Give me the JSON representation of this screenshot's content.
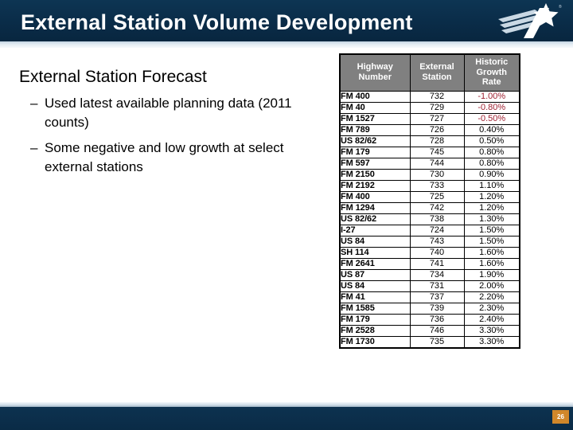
{
  "header": {
    "title": "External Station Volume Development",
    "logo_icon": "star-swoosh-logo",
    "bg_color": "#0b2f4d"
  },
  "content": {
    "heading": "External Station Forecast",
    "bullets": [
      {
        "dash": "–",
        "text": "Used latest available planning data (2011 counts)"
      },
      {
        "dash": "–",
        "text": "Some negative and low growth at select external stations"
      }
    ]
  },
  "table": {
    "columns": [
      "Highway Number",
      "External Station",
      "Historic Growth Rate"
    ],
    "header_bg": "#808080",
    "negative_color": "#a02334",
    "rows": [
      {
        "highway": "FM 400",
        "station": "732",
        "rate": "-1.00%",
        "negative": true
      },
      {
        "highway": "FM 40",
        "station": "729",
        "rate": "-0.80%",
        "negative": true
      },
      {
        "highway": "FM 1527",
        "station": "727",
        "rate": "-0.50%",
        "negative": true
      },
      {
        "highway": "FM 789",
        "station": "726",
        "rate": "0.40%",
        "negative": false
      },
      {
        "highway": "US 82/62",
        "station": "728",
        "rate": "0.50%",
        "negative": false
      },
      {
        "highway": "FM 179",
        "station": "745",
        "rate": "0.80%",
        "negative": false
      },
      {
        "highway": "FM 597",
        "station": "744",
        "rate": "0.80%",
        "negative": false
      },
      {
        "highway": "FM 2150",
        "station": "730",
        "rate": "0.90%",
        "negative": false
      },
      {
        "highway": "FM 2192",
        "station": "733",
        "rate": "1.10%",
        "negative": false
      },
      {
        "highway": "FM 400",
        "station": "725",
        "rate": "1.20%",
        "negative": false
      },
      {
        "highway": "FM 1294",
        "station": "742",
        "rate": "1.20%",
        "negative": false
      },
      {
        "highway": "US 82/62",
        "station": "738",
        "rate": "1.30%",
        "negative": false
      },
      {
        "highway": "I-27",
        "station": "724",
        "rate": "1.50%",
        "negative": false
      },
      {
        "highway": "US 84",
        "station": "743",
        "rate": "1.50%",
        "negative": false
      },
      {
        "highway": "SH 114",
        "station": "740",
        "rate": "1.60%",
        "negative": false
      },
      {
        "highway": "FM 2641",
        "station": "741",
        "rate": "1.60%",
        "negative": false
      },
      {
        "highway": "US 87",
        "station": "734",
        "rate": "1.90%",
        "negative": false
      },
      {
        "highway": "US 84",
        "station": "731",
        "rate": "2.00%",
        "negative": false
      },
      {
        "highway": "FM 41",
        "station": "737",
        "rate": "2.20%",
        "negative": false
      },
      {
        "highway": "FM 1585",
        "station": "739",
        "rate": "2.30%",
        "negative": false
      },
      {
        "highway": "FM 179",
        "station": "736",
        "rate": "2.40%",
        "negative": false
      },
      {
        "highway": "FM 2528",
        "station": "746",
        "rate": "3.30%",
        "negative": false
      },
      {
        "highway": "FM 1730",
        "station": "735",
        "rate": "3.30%",
        "negative": false
      }
    ]
  },
  "footer": {
    "page_number": "26",
    "badge_color": "#d1872a"
  }
}
